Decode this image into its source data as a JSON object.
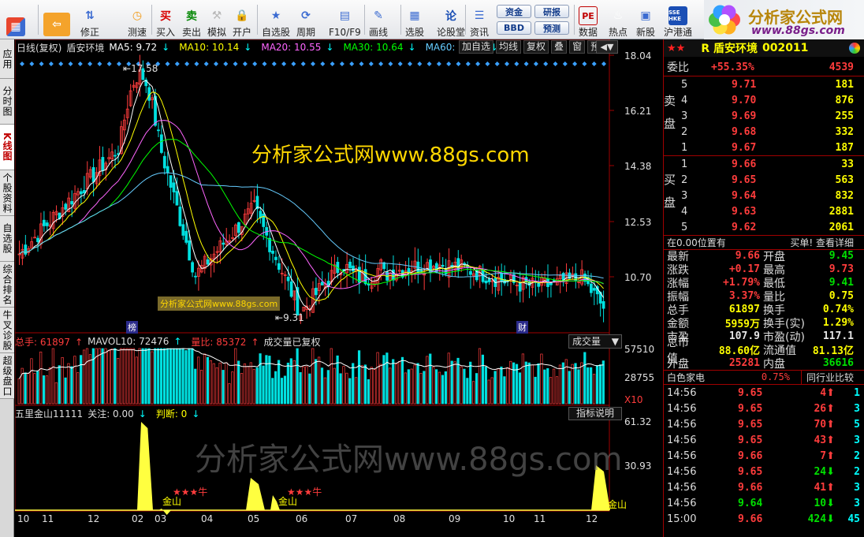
{
  "toolbar": {
    "buttons": [
      {
        "label": "",
        "icon": "grid-icon"
      },
      {
        "label": "",
        "icon": "back-arrow-icon"
      },
      {
        "label": "修正",
        "icon": "arrow-updown-icon"
      },
      {
        "label": "测速",
        "icon": "clock-icon"
      },
      {
        "label": "测速",
        "icon": "clock-icon"
      },
      {
        "label": "买入",
        "icon": "buy-icon",
        "glyph": "买"
      },
      {
        "label": "卖出",
        "icon": "sell-icon",
        "glyph": "卖"
      },
      {
        "label": "模拟",
        "icon": "hammer-icon"
      },
      {
        "label": "开户",
        "icon": "lock-icon"
      },
      {
        "label": "自选股",
        "icon": "star-folder-icon"
      },
      {
        "label": "周期",
        "icon": "period-icon"
      },
      {
        "label": "F10/F9",
        "icon": "f10-icon"
      },
      {
        "label": "画线",
        "icon": "pencil-icon"
      },
      {
        "label": "选股",
        "icon": "select-stock-icon"
      },
      {
        "label": "论股堂",
        "icon": "forum-icon",
        "glyph": "论"
      },
      {
        "label": "资讯",
        "icon": "news-icon"
      },
      {
        "label": "数据",
        "icon": "pe-icon",
        "glyph": "PE"
      },
      {
        "label": "热点",
        "icon": "fire-icon"
      },
      {
        "label": "新股",
        "icon": "new-stock-icon"
      },
      {
        "label": "沪港通",
        "icon": "hk-connect-icon",
        "glyph": "SSE HKE"
      }
    ],
    "pills": [
      "资金",
      "研报",
      "BBD",
      "预测"
    ],
    "logo_text": "分析家公式网",
    "logo_url": "www.88gs.com"
  },
  "sidetabs": [
    "应用",
    "分时图",
    "K线图",
    "个股资料",
    "自选股",
    "综合排名",
    "牛叉诊股",
    "超级盘口"
  ],
  "kline_header": {
    "title": "日线(复权)",
    "name": "盾安环境",
    "ma": [
      {
        "label": "MA5: 9.72",
        "color": "#ffffff"
      },
      {
        "label": "MA10: 10.14",
        "color": "#ffff00"
      },
      {
        "label": "MA20: 10.55",
        "color": "#ff66ff"
      },
      {
        "label": "MA30: 10.64",
        "color": "#00ff00"
      },
      {
        "label": "MA60: 10.63",
        "color": "#66ccff"
      }
    ],
    "buttons": [
      "加自选",
      "均线",
      "复权",
      "叠",
      "窗",
      "预测"
    ],
    "y_ticks": [
      "18.04",
      "16.21",
      "14.38",
      "12.53",
      "10.70"
    ],
    "high_label": "17.58",
    "low_label": "9.31",
    "tag_bang": "榜",
    "tag_cai": "财",
    "watermark": "分析家公式网www.88gs.com",
    "small_watermark": "分析家公式网www.88gs.com"
  },
  "volume_header": {
    "total": "总手: 61897",
    "mavol": "MAVOL10: 72476",
    "liangbi": "量比: 85372",
    "note": "成交量已复权",
    "dropdown": "成交量",
    "y_ticks": [
      "57510",
      "28755"
    ],
    "x_unit": "X10"
  },
  "indicator_header": {
    "name": "五里金山11111",
    "guanzhu": "关注: 0.00",
    "panduan": "判断: 0",
    "button": "指标说明",
    "y_ticks": [
      "61.32",
      "30.93"
    ],
    "watermark": "分析家公式网www.88gs.com",
    "signals": [
      {
        "text": "★★★牛",
        "sub": "金山"
      },
      {
        "text": "★★★牛",
        "sub": "金山"
      },
      {
        "text": "",
        "sub": "金山"
      }
    ]
  },
  "x_axis": [
    "10",
    "11",
    "12",
    "02",
    "03",
    "04",
    "05",
    "06",
    "07",
    "08",
    "09",
    "10",
    "11",
    "12"
  ],
  "quote": {
    "stock_name": "R 盾安环境",
    "code": "002011",
    "weibi_label": "委比",
    "weibi_value": "+55.35%",
    "weicha": "4539",
    "sell_label": "卖盘",
    "buy_label": "买盘",
    "sell": [
      {
        "n": "5",
        "price": "9.71",
        "vol": "181"
      },
      {
        "n": "4",
        "price": "9.70",
        "vol": "876"
      },
      {
        "n": "3",
        "price": "9.69",
        "vol": "255"
      },
      {
        "n": "2",
        "price": "9.68",
        "vol": "332"
      },
      {
        "n": "1",
        "price": "9.67",
        "vol": "187"
      }
    ],
    "buy": [
      {
        "n": "1",
        "price": "9.66",
        "vol": "33"
      },
      {
        "n": "2",
        "price": "9.65",
        "vol": "563"
      },
      {
        "n": "3",
        "price": "9.64",
        "vol": "832"
      },
      {
        "n": "4",
        "price": "9.63",
        "vol": "2881"
      },
      {
        "n": "5",
        "price": "9.62",
        "vol": "2061"
      }
    ],
    "position_note": "在0.00位置有",
    "detail_link": "买单! 查看详细",
    "stats": [
      [
        "最新",
        "9.66",
        "开盘",
        "9.45"
      ],
      [
        "涨跌",
        "+0.17",
        "最高",
        "9.73"
      ],
      [
        "涨幅",
        "+1.79%",
        "最低",
        "9.41"
      ],
      [
        "振幅",
        "3.37%",
        "量比",
        "0.75"
      ],
      [
        "总手",
        "61897",
        "换手",
        "0.74%"
      ],
      [
        "金额",
        "5959万",
        "换手(实)",
        "1.29%"
      ],
      [
        "市盈",
        "107.9",
        "市盈(动)",
        "117.1"
      ],
      [
        "总市值",
        "88.60亿",
        "流通值",
        "81.13亿"
      ],
      [
        "外盘",
        "25281",
        "内盘",
        "36616"
      ]
    ],
    "industry": "白色家电",
    "industry_pct": "0.75%",
    "compare": "同行业比较",
    "ticks": [
      {
        "t": "14:56",
        "p": "9.65",
        "v": "4",
        "dir": "up",
        "n": "1"
      },
      {
        "t": "14:56",
        "p": "9.65",
        "v": "26",
        "dir": "up",
        "n": "3"
      },
      {
        "t": "14:56",
        "p": "9.65",
        "v": "70",
        "dir": "up",
        "n": "5"
      },
      {
        "t": "14:56",
        "p": "9.65",
        "v": "43",
        "dir": "up",
        "n": "3"
      },
      {
        "t": "14:56",
        "p": "9.66",
        "v": "7",
        "dir": "up",
        "n": "2"
      },
      {
        "t": "14:56",
        "p": "9.65",
        "v": "24",
        "dir": "down",
        "n": "2"
      },
      {
        "t": "14:56",
        "p": "9.66",
        "v": "41",
        "dir": "up",
        "n": "3"
      },
      {
        "t": "14:56",
        "p": "9.64",
        "v": "10",
        "dir": "down",
        "n": "3"
      },
      {
        "t": "15:00",
        "p": "9.66",
        "v": "424",
        "dir": "down",
        "n": "45"
      }
    ]
  }
}
